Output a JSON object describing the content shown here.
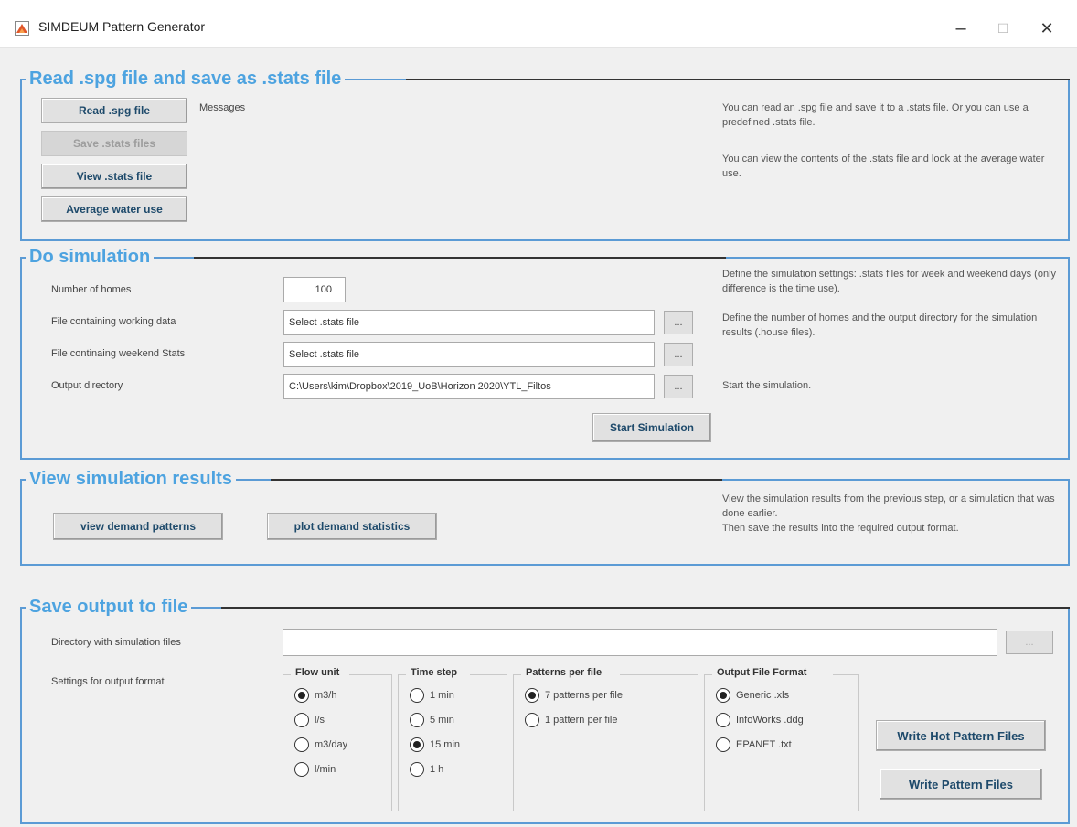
{
  "window": {
    "title": "SIMDEUM Pattern Generator",
    "minimize": "–",
    "maximize": "☐",
    "close": "✕"
  },
  "read_section": {
    "title": "Read .spg file and save as .stats file",
    "read_button": "Read .spg file",
    "save_button": "Save .stats files",
    "view_button": "View .stats file",
    "average_button": "Average water use",
    "messages_label": "Messages",
    "info_1": "You can read an .spg file and save it to a .stats file. Or you can use a predefined .stats file.",
    "info_2": "You can view the contents of the .stats file and look at the average water use."
  },
  "simulation_section": {
    "title": "Do simulation",
    "homes_label": "Number of homes",
    "homes_value": "100",
    "working_label": "File containing working data",
    "working_value": "Select .stats file",
    "weekend_label": "File continaing weekend Stats",
    "weekend_value": "Select .stats file",
    "output_label": "Output directory",
    "output_value": "C:\\Users\\kim\\Dropbox\\2019_UoB\\Horizon 2020\\YTL_Filtos",
    "browse": "...",
    "start_button": "Start Simulation",
    "info_1": "Define the simulation settings: .stats files for week and weekend days (only difference is the time use).",
    "info_2": "Define the number of homes and the output directory for the simulation results (.house files).",
    "info_3": "Start the simulation."
  },
  "results_section": {
    "title": "View simulation results",
    "view_button": "view demand patterns",
    "plot_button": "plot demand statistics",
    "info_1": "View the simulation results from the previous step, or a simulation that was done earlier.",
    "info_2": "Then save the results into the required output format."
  },
  "output_section": {
    "title": "Save output to file",
    "directory_label": "Directory with simulation files",
    "directory_value": "",
    "browse": "...",
    "settings_label": "Settings for output format",
    "flow_unit": {
      "title": "Flow unit",
      "options": [
        "m3/h",
        "l/s",
        "m3/day",
        "l/min"
      ],
      "selected": "m3/h"
    },
    "time_step": {
      "title": "Time step",
      "options": [
        "1 min",
        "5 min",
        "15 min",
        "1 h"
      ],
      "selected": "15 min"
    },
    "patterns_per_file": {
      "title": "Patterns per file",
      "options": [
        "7 patterns per file",
        "1 pattern per file"
      ],
      "selected": "7 patterns per file"
    },
    "file_format": {
      "title": "Output File Format",
      "options": [
        "Generic .xls",
        "InfoWorks .ddg",
        "EPANET .txt"
      ],
      "selected": "Generic .xls"
    },
    "write_hot_button": "Write Hot Pattern Files",
    "write_button": "Write Pattern Files"
  }
}
